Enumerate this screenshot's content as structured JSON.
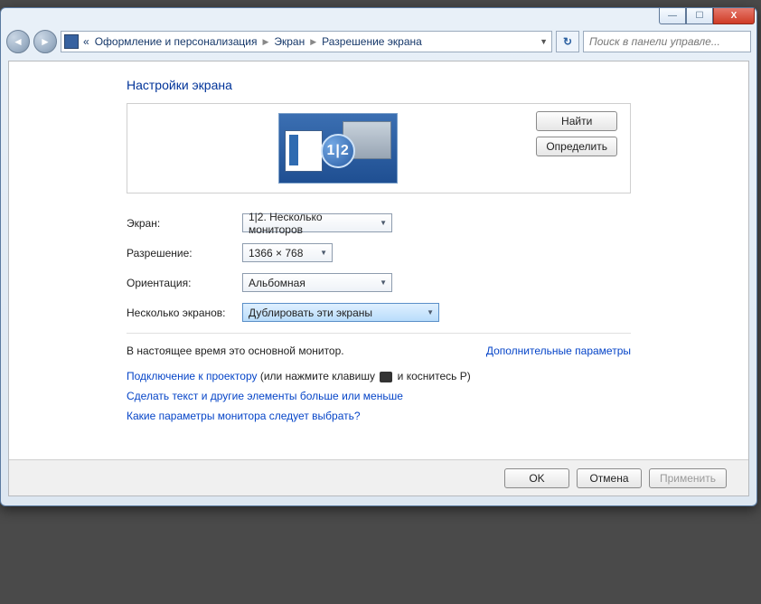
{
  "titlebar": {
    "minimize": "—",
    "maximize": "☐",
    "close": "X"
  },
  "nav": {
    "back_glyph": "◄",
    "fwd_glyph": "►",
    "chev": "«",
    "crumb1": "Оформление и персонализация",
    "crumb2": "Экран",
    "crumb3": "Разрешение экрана",
    "addr_dropdown": "▼",
    "refresh": "↻",
    "search_placeholder": "Поиск в панели управле..."
  },
  "page": {
    "heading": "Настройки экрана",
    "monitor_badge": "1|2",
    "btn_find": "Найти",
    "btn_identify": "Определить"
  },
  "form": {
    "screen_label": "Экран:",
    "screen_value": "1|2. Несколько мониторов",
    "resolution_label": "Разрешение:",
    "resolution_value": "1366 × 768",
    "orientation_label": "Ориентация:",
    "orientation_value": "Альбомная",
    "multi_label": "Несколько экранов:",
    "multi_value": "Дублировать эти экраны"
  },
  "status": {
    "main_monitor": "В настоящее время это основной монитор.",
    "advanced": "Дополнительные параметры"
  },
  "links": {
    "projector_link": "Подключение к проектору",
    "projector_rest_a": " (или нажмите клавишу ",
    "projector_rest_b": " и коснитесь P)",
    "text_size": "Сделать текст и другие элементы больше или меньше",
    "which_params": "Какие параметры монитора следует выбрать?"
  },
  "footer": {
    "ok": "OK",
    "cancel": "Отмена",
    "apply": "Применить"
  }
}
